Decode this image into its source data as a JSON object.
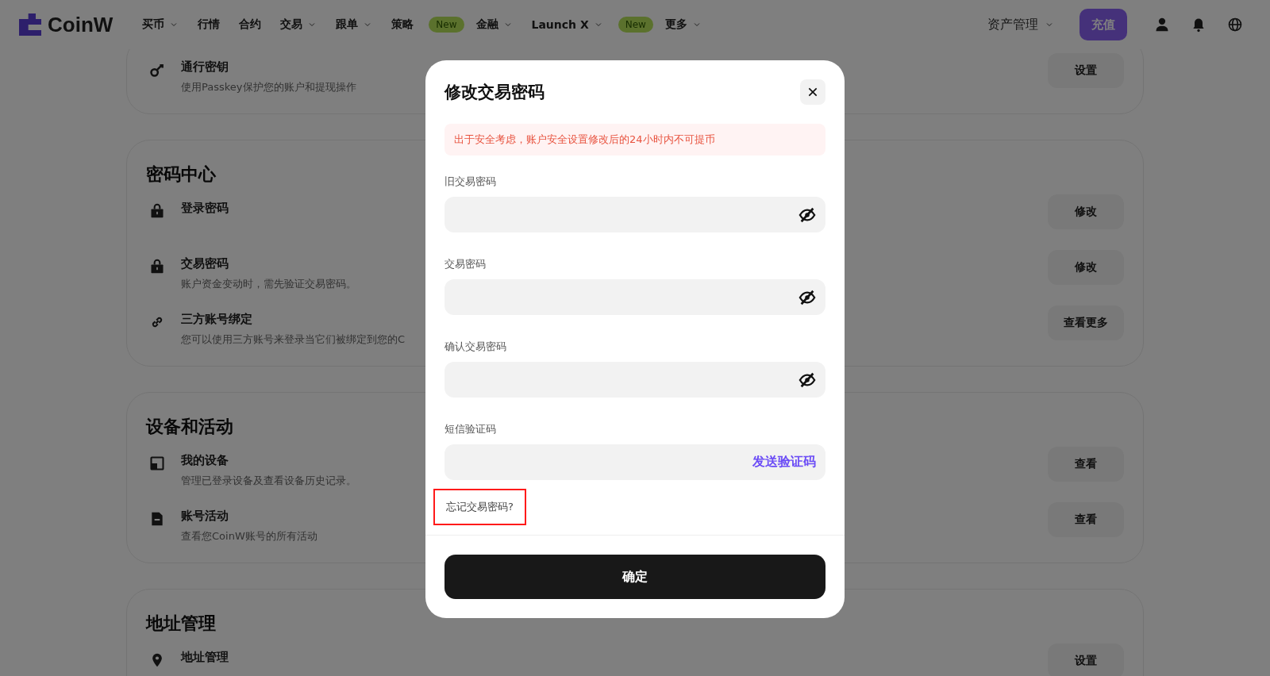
{
  "nav": {
    "logo": "CoinW",
    "items": [
      {
        "label": "买币",
        "dropdown": true
      },
      {
        "label": "行情",
        "dropdown": false
      },
      {
        "label": "合约",
        "dropdown": false
      },
      {
        "label": "交易",
        "dropdown": true
      },
      {
        "label": "跟单",
        "dropdown": true
      },
      {
        "label": "策略",
        "dropdown": false,
        "badge": "New"
      },
      {
        "label": "金融",
        "dropdown": true
      },
      {
        "label": "Launch X",
        "dropdown": true,
        "badge": "New"
      },
      {
        "label": "更多",
        "dropdown": true
      }
    ],
    "asset_menu": "资产管理",
    "deposit": "充值"
  },
  "sections": [
    {
      "rows": [
        {
          "kind": "key",
          "title": "通行密钥",
          "description": "使用Passkey保护您的账户和提现操作",
          "button": "设置"
        }
      ]
    },
    {
      "title": "密码中心",
      "rows": [
        {
          "kind": "lock",
          "title": "登录密码",
          "button": "修改"
        },
        {
          "kind": "lock",
          "title": "交易密码",
          "description": "账户资金变动时，需先验证交易密码。",
          "button": "修改"
        },
        {
          "kind": "link",
          "title": "三方账号绑定",
          "description": "您可以使用三方账号来登录当它们被绑定到您的C",
          "button": "查看更多"
        }
      ]
    },
    {
      "title": "设备和活动",
      "rows": [
        {
          "kind": "device",
          "title": "我的设备",
          "description": "管理已登录设备及查看设备历史记录。",
          "button": "查看"
        },
        {
          "kind": "document",
          "title": "账号活动",
          "description": "查看您CoinW账号的所有活动",
          "button": "查看"
        }
      ]
    },
    {
      "title": "地址管理",
      "rows": [
        {
          "kind": "pin",
          "title": "地址管理",
          "button": "设置"
        }
      ]
    }
  ],
  "modal": {
    "title": "修改交易密码",
    "notice": "出于安全考虑，账户安全设置修改后的24小时内不可提币",
    "fields": [
      {
        "kind": "password",
        "label": "旧交易密码"
      },
      {
        "kind": "password",
        "label": "交易密码"
      },
      {
        "kind": "password",
        "label": "确认交易密码"
      },
      {
        "kind": "code",
        "label": "短信验证码",
        "action": "发送验证码"
      }
    ],
    "forgot": {
      "text": "忘记交易密码?",
      "highlighted": true
    },
    "confirm": "确定"
  }
}
